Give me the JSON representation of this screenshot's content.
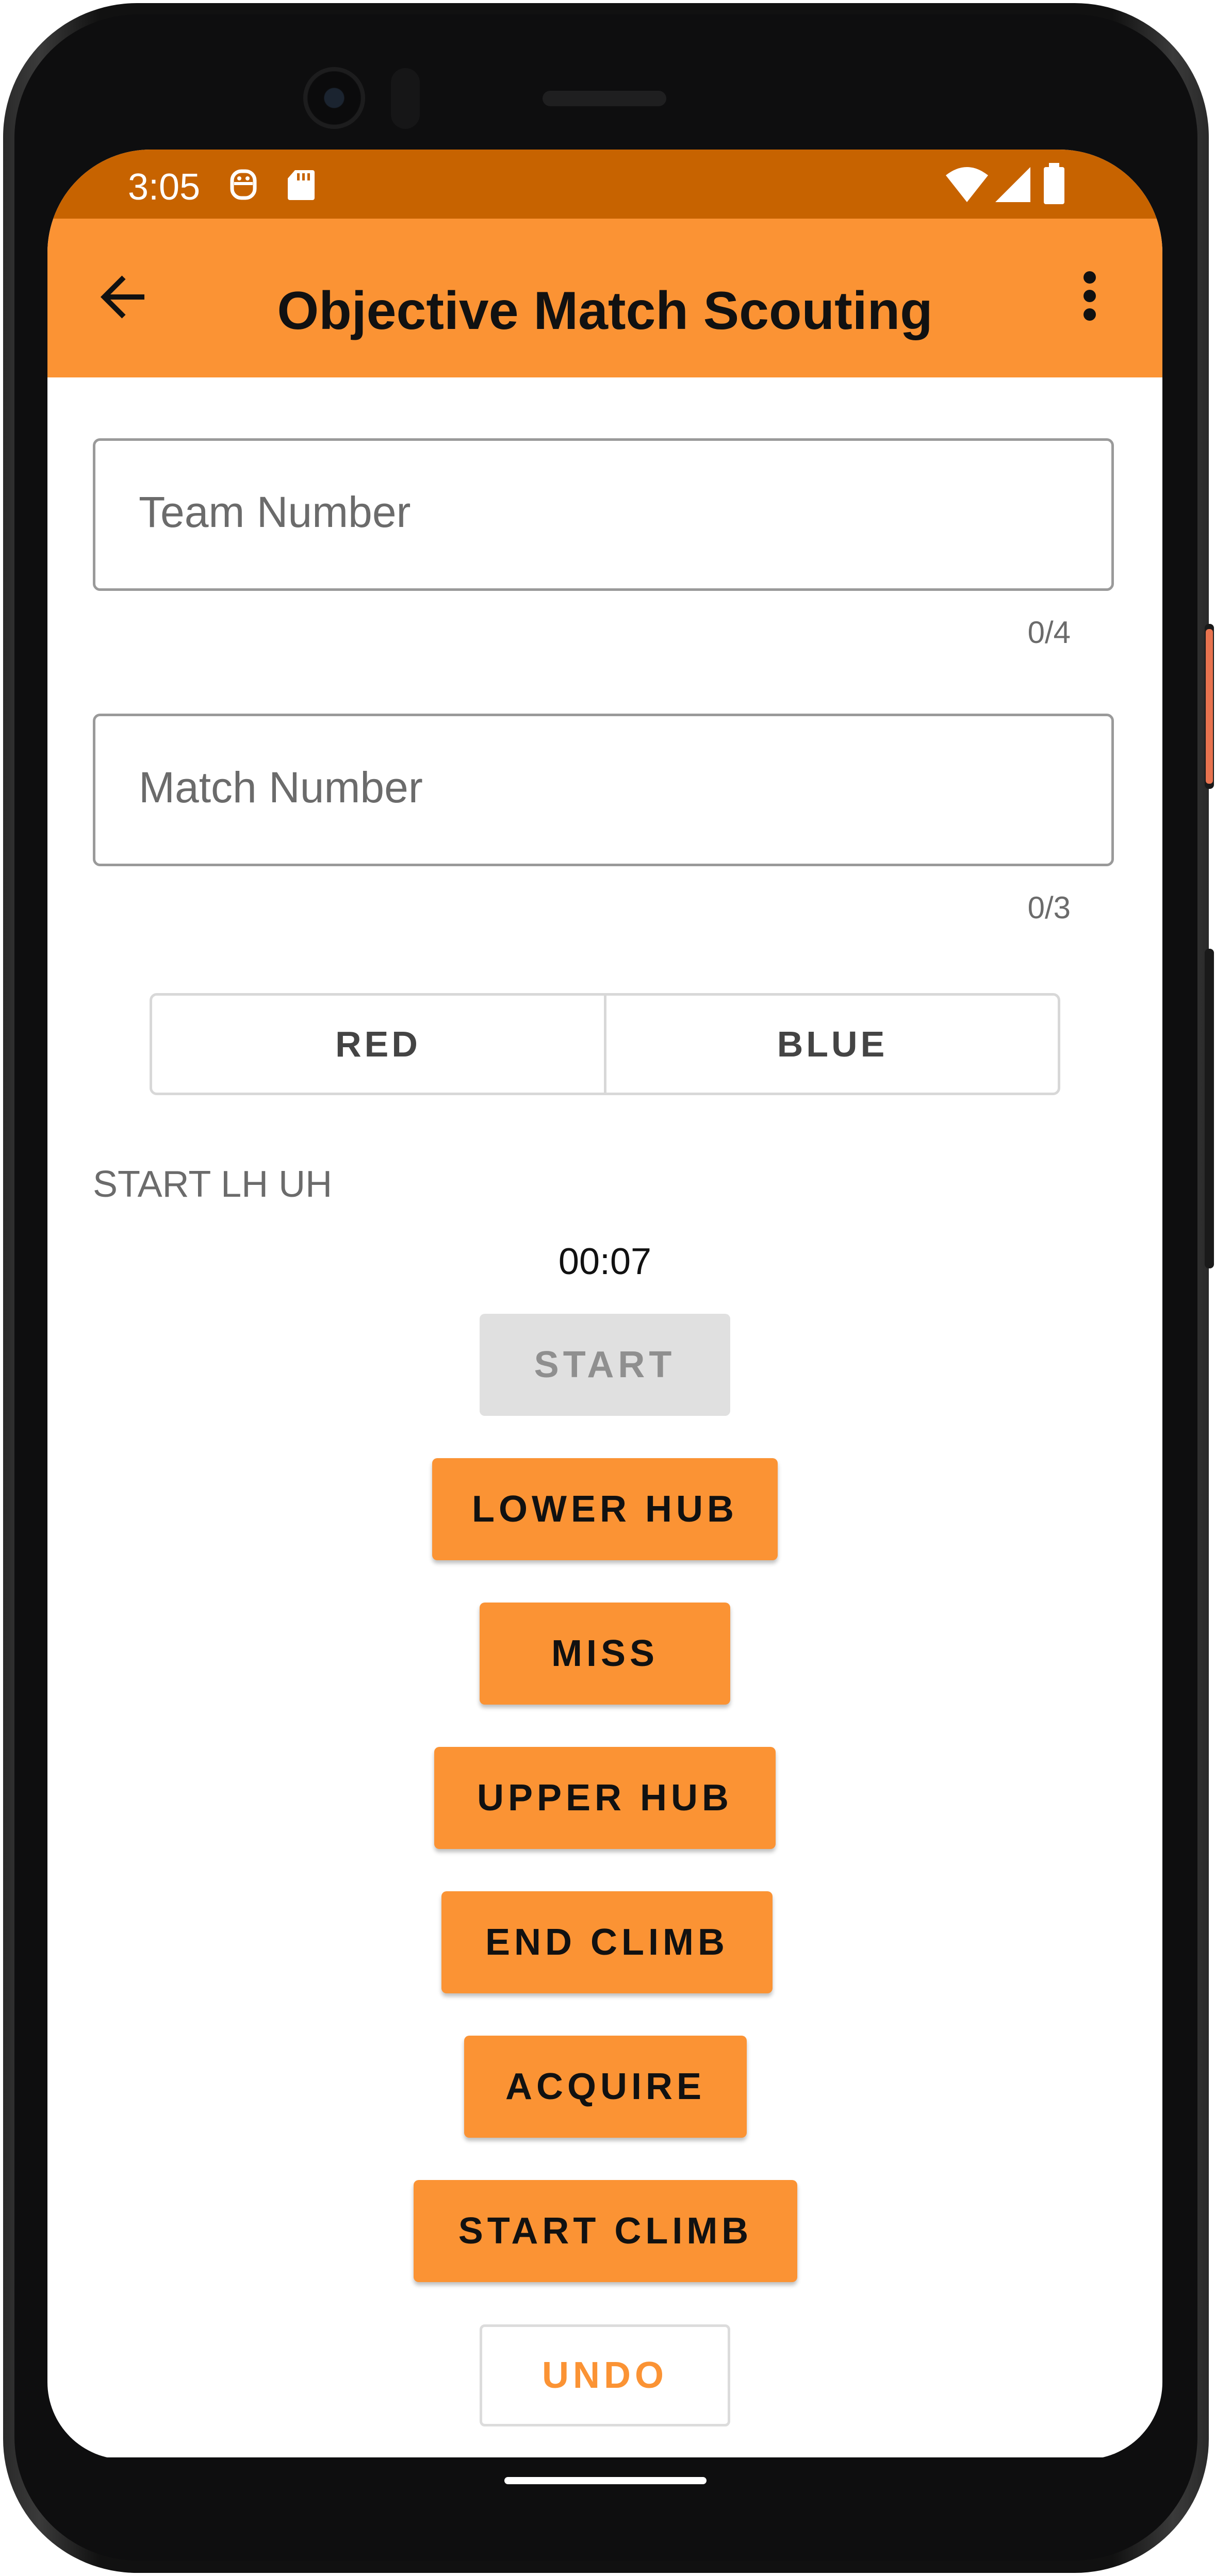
{
  "status_bar": {
    "time": "3:05",
    "icons": [
      "wifi-icon",
      "signal-icon",
      "battery-icon",
      "app-notification-icon",
      "sd-card-icon"
    ]
  },
  "app_bar": {
    "title": "Objective Match Scouting",
    "back_icon": "arrow-left-icon",
    "menu_icon": "more-vert-icon"
  },
  "form": {
    "team_number": {
      "placeholder": "Team Number",
      "value": "",
      "counter": "0/4"
    },
    "match_number": {
      "placeholder": "Match Number",
      "value": "",
      "counter": "0/3"
    },
    "alliance": {
      "options": [
        "RED",
        "BLUE"
      ]
    }
  },
  "log": {
    "text": "START LH UH",
    "timer": "00:07"
  },
  "buttons": {
    "start": "START",
    "lower_hub": "LOWER HUB",
    "miss": "MISS",
    "upper_hub": "UPPER HUB",
    "end_climb": "END CLIMB",
    "acquire": "ACQUIRE",
    "start_climb": "START CLIMB",
    "undo": "UNDO"
  },
  "colors": {
    "status_bar": "#c76300",
    "app_bar": "#fb9334",
    "accent": "#fb9334",
    "disabled": "#e0e0e0"
  }
}
